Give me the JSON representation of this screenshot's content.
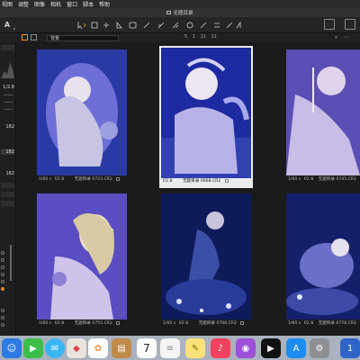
{
  "menubar": {
    "items": [
      "视图",
      "调整",
      "图像",
      "相机",
      "窗口",
      "脚本",
      "帮助"
    ]
  },
  "window": {
    "title": "无题目录"
  },
  "toolbar": {
    "logo": "A"
  },
  "filter": {
    "select_value": "背景",
    "counts": [
      "5",
      "1",
      "11",
      "11"
    ]
  },
  "left_panel": {
    "values": [
      "1/2.8",
      "182",
      "182",
      "182"
    ]
  },
  "thumbnails": [
    {
      "shutter": "1/60 s",
      "aperture": "f/2.8",
      "filename": "无题目录 0723.CR2",
      "selected": false
    },
    {
      "shutter": "f/2.8",
      "aperture": "",
      "filename": "无题目录 0668.CR2",
      "selected": true
    },
    {
      "shutter": "1/60 s",
      "aperture": "f/2.8",
      "filename": "无题目录 0745.CR2",
      "selected": false
    },
    {
      "shutter": "1/60 s",
      "aperture": "f/2.8",
      "filename": "无题目录 0755.CR2",
      "selected": false
    },
    {
      "shutter": "1/60 s",
      "aperture": "f/2.8",
      "filename": "无题目录 0766.CR2",
      "selected": false
    },
    {
      "shutter": "1/60 s",
      "aperture": "f/2.8",
      "filename": "无题目录 0778.CR2",
      "selected": false
    }
  ],
  "dock": {
    "calendar_day": "7"
  },
  "colors": {
    "accent_orange": "#f08a24",
    "photo_purple": "#6d5fc8",
    "photo_blue": "#1b2a7a"
  }
}
